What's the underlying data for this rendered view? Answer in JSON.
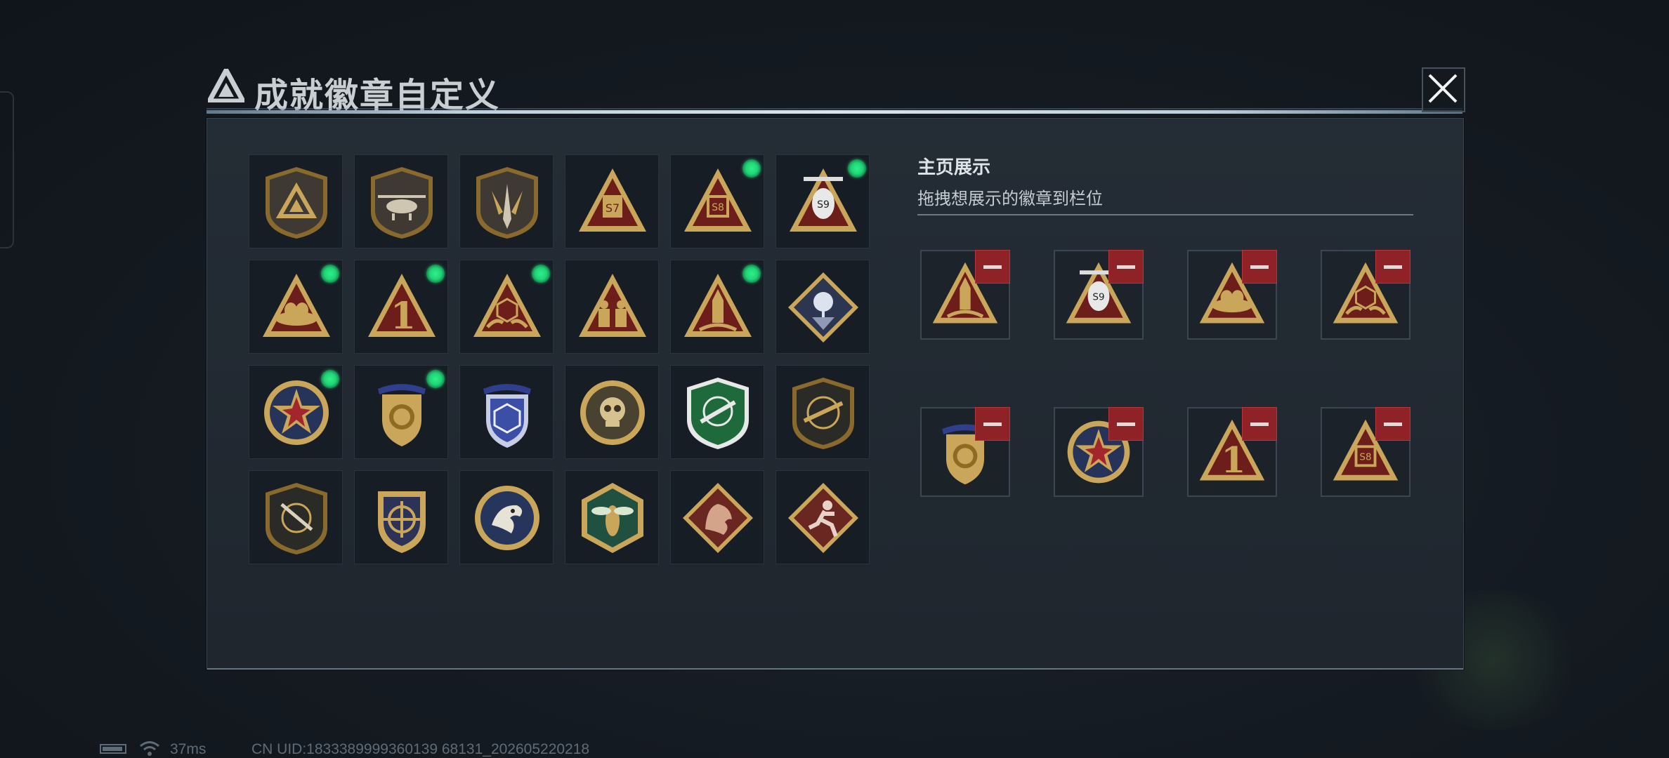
{
  "dialog": {
    "title": "成就徽章自定义",
    "close_icon": "close-icon",
    "logo_icon": "delta-triangle-logo-icon"
  },
  "badge_grid": [
    {
      "icon": "triangle-shield-badge",
      "equipped": false
    },
    {
      "icon": "helicopter-shield-badge",
      "equipped": false
    },
    {
      "icon": "dagger-shield-badge",
      "equipped": false
    },
    {
      "icon": "s7-triangle-badge",
      "equipped": false
    },
    {
      "icon": "s8-triangle-badge",
      "equipped": true
    },
    {
      "icon": "s9-helicopter-triangle-badge",
      "equipped": true
    },
    {
      "icon": "egg-nest-triangle-badge",
      "equipped": true
    },
    {
      "icon": "number-one-triangle-badge",
      "equipped": true
    },
    {
      "icon": "d20-hands-triangle-badge",
      "equipped": true
    },
    {
      "icon": "soldiers-triangle-badge",
      "equipped": false
    },
    {
      "icon": "rocket-triangle-badge",
      "equipped": true
    },
    {
      "icon": "rose-diamond-badge",
      "equipped": false
    },
    {
      "icon": "star-medal-badge",
      "equipped": true
    },
    {
      "icon": "gold-crest-badge",
      "equipped": true
    },
    {
      "icon": "blue-d20-crest-badge",
      "equipped": false
    },
    {
      "icon": "skull-round-badge",
      "equipped": false
    },
    {
      "icon": "green-rifle-shield-badge",
      "equipped": false
    },
    {
      "icon": "dark-rifle-shield-badge",
      "equipped": false
    },
    {
      "icon": "sniper-shield-badge",
      "equipped": false
    },
    {
      "icon": "crosshair-gold-shield-badge",
      "equipped": false
    },
    {
      "icon": "eagle-round-badge",
      "equipped": false
    },
    {
      "icon": "wasp-hexagon-badge",
      "equipped": false
    },
    {
      "icon": "dragon-diamond-badge",
      "equipped": false
    },
    {
      "icon": "runner-diamond-badge",
      "equipped": false
    }
  ],
  "showcase": {
    "title": "主页展示",
    "subtitle": "拖拽想展示的徽章到栏位",
    "remove_icon": "minus-icon",
    "slots": [
      {
        "icon": "rocket-triangle-badge"
      },
      {
        "icon": "s9-helicopter-triangle-badge"
      },
      {
        "icon": "egg-nest-triangle-badge"
      },
      {
        "icon": "d20-hands-triangle-badge"
      },
      {
        "icon": "gold-crest-badge"
      },
      {
        "icon": "star-medal-badge"
      },
      {
        "icon": "number-one-triangle-badge"
      },
      {
        "icon": "s8-triangle-badge"
      }
    ]
  },
  "status_bar": {
    "battery_icon": "battery-icon",
    "wifi_icon": "wifi-icon",
    "ping": "37ms",
    "uid": "CN UID:1833389999360139 68131_202605220218"
  },
  "colors": {
    "equipped_dot": "#22d877",
    "remove_button": "#8e2226",
    "gold": "#c9a659",
    "triangle_red": "#6e1e1a"
  }
}
